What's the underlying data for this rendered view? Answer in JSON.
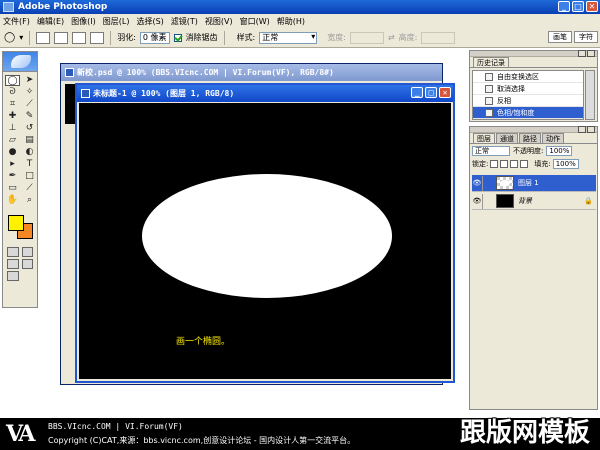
{
  "app": {
    "title": "Adobe Photoshop",
    "window_buttons": [
      "_",
      "□",
      "✕"
    ]
  },
  "menu": [
    "文件(F)",
    "编辑(E)",
    "图像(I)",
    "图层(L)",
    "选择(S)",
    "滤镜(T)",
    "视图(V)",
    "窗口(W)",
    "帮助(H)"
  ],
  "options": {
    "feather_label": "羽化:",
    "feather_value": "0 像素",
    "antialias_label": "消除锯齿",
    "style_label": "样式:",
    "style_value": "正常",
    "width_label": "宽度:",
    "height_label": "高度:",
    "palette_tabs": [
      "画笔",
      "字符"
    ]
  },
  "doc_back": {
    "title": "新校.psd @ 100% (BBS.VIcnc.COM | VI.Forum(VF), RGB/8#)"
  },
  "doc_front": {
    "title": "未标题-1 @ 100% (图层 1, RGB/8)",
    "caption": "画一个椭圆。",
    "canvas_color": "#000000",
    "shape_color": "#ffffff",
    "caption_color": "#f5e600"
  },
  "history": {
    "tab": "历史记录",
    "items": [
      "自由变换选区",
      "取消选择",
      "反相",
      "色相/饱和度"
    ],
    "selected_index": 3
  },
  "layers": {
    "tabs": [
      "图层",
      "通道",
      "路径",
      "动作"
    ],
    "blend_mode": "正常",
    "opacity_label": "不透明度:",
    "opacity_value": "100%",
    "lock_label": "锁定:",
    "fill_label": "填充:",
    "fill_value": "100%",
    "rows": [
      {
        "name": "图层 1",
        "selected": true
      },
      {
        "name": "背景",
        "selected": false
      }
    ]
  },
  "colors": {
    "foreground": "#fff200",
    "background": "#f48624",
    "selection": "#2f5fcf"
  },
  "banner": {
    "logo": "VA",
    "line1": "BBS.VIcnc.COM | VI.Forum(VF)",
    "line2": "Copyright (C)CAT,来源：bbs.vicnc.com,创意设计论坛 - 国内设计人第一交流平台。",
    "watermark": "跟版网模板"
  }
}
